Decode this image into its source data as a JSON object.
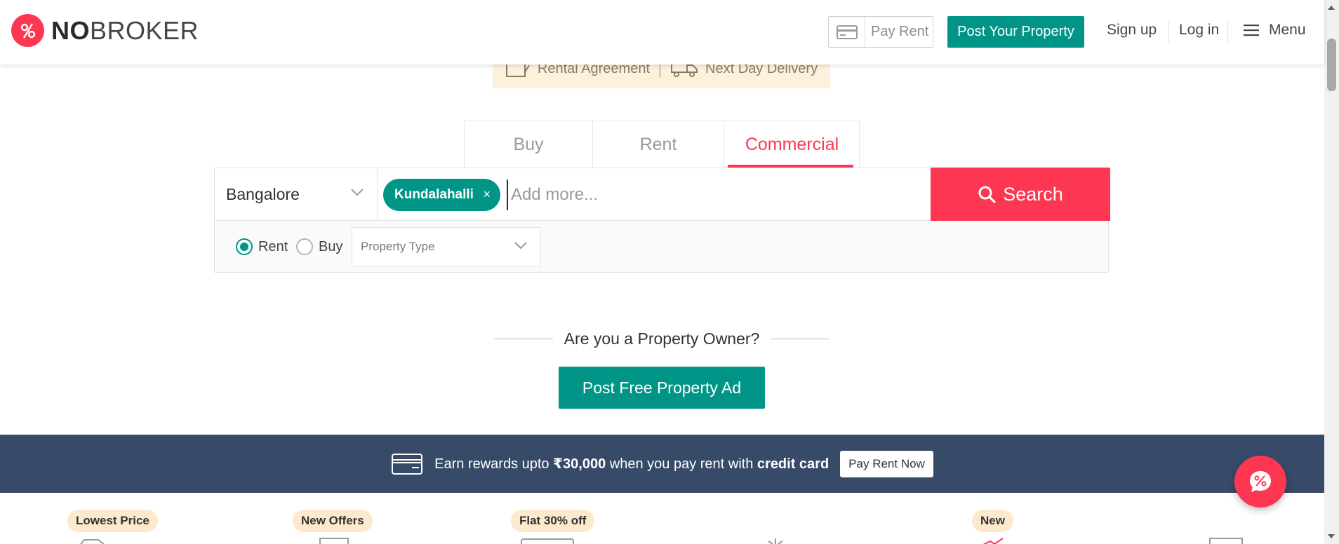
{
  "header": {
    "logo_bold": "NO",
    "logo_rest": "BROKER",
    "pay_rent": "Pay Rent",
    "post_property": "Post Your Property",
    "sign_up": "Sign up",
    "log_in": "Log in",
    "menu": "Menu"
  },
  "promo": {
    "rental_agreement": "Rental Agreement",
    "next_day_delivery": "Next Day Delivery"
  },
  "tabs": [
    {
      "label": "Buy",
      "active": false
    },
    {
      "label": "Rent",
      "active": false
    },
    {
      "label": "Commercial",
      "active": true
    }
  ],
  "search": {
    "city": "Bangalore",
    "chip": "Kundalahalli",
    "chip_remove": "×",
    "placeholder": "Add more...",
    "button": "Search",
    "options": {
      "rent": "Rent",
      "buy": "Buy",
      "selected": "Rent",
      "property_type_placeholder": "Property Type"
    }
  },
  "owner": {
    "question": "Are you a Property Owner?",
    "cta": "Post Free Property Ad"
  },
  "rewards": {
    "pre": "Earn rewards upto",
    "amount": "₹30,000",
    "mid": "when you pay rent with",
    "bold_tail": "credit card",
    "button": "Pay Rent Now"
  },
  "badges": [
    "Lowest Price",
    "New Offers",
    "Flat 30% off",
    "New"
  ],
  "colors": {
    "brand_red": "#fd3752",
    "brand_teal": "#009587",
    "rewards_bg": "#374a68",
    "promo_bg": "#fdf1dc",
    "badge_bg": "#fde9cc"
  }
}
